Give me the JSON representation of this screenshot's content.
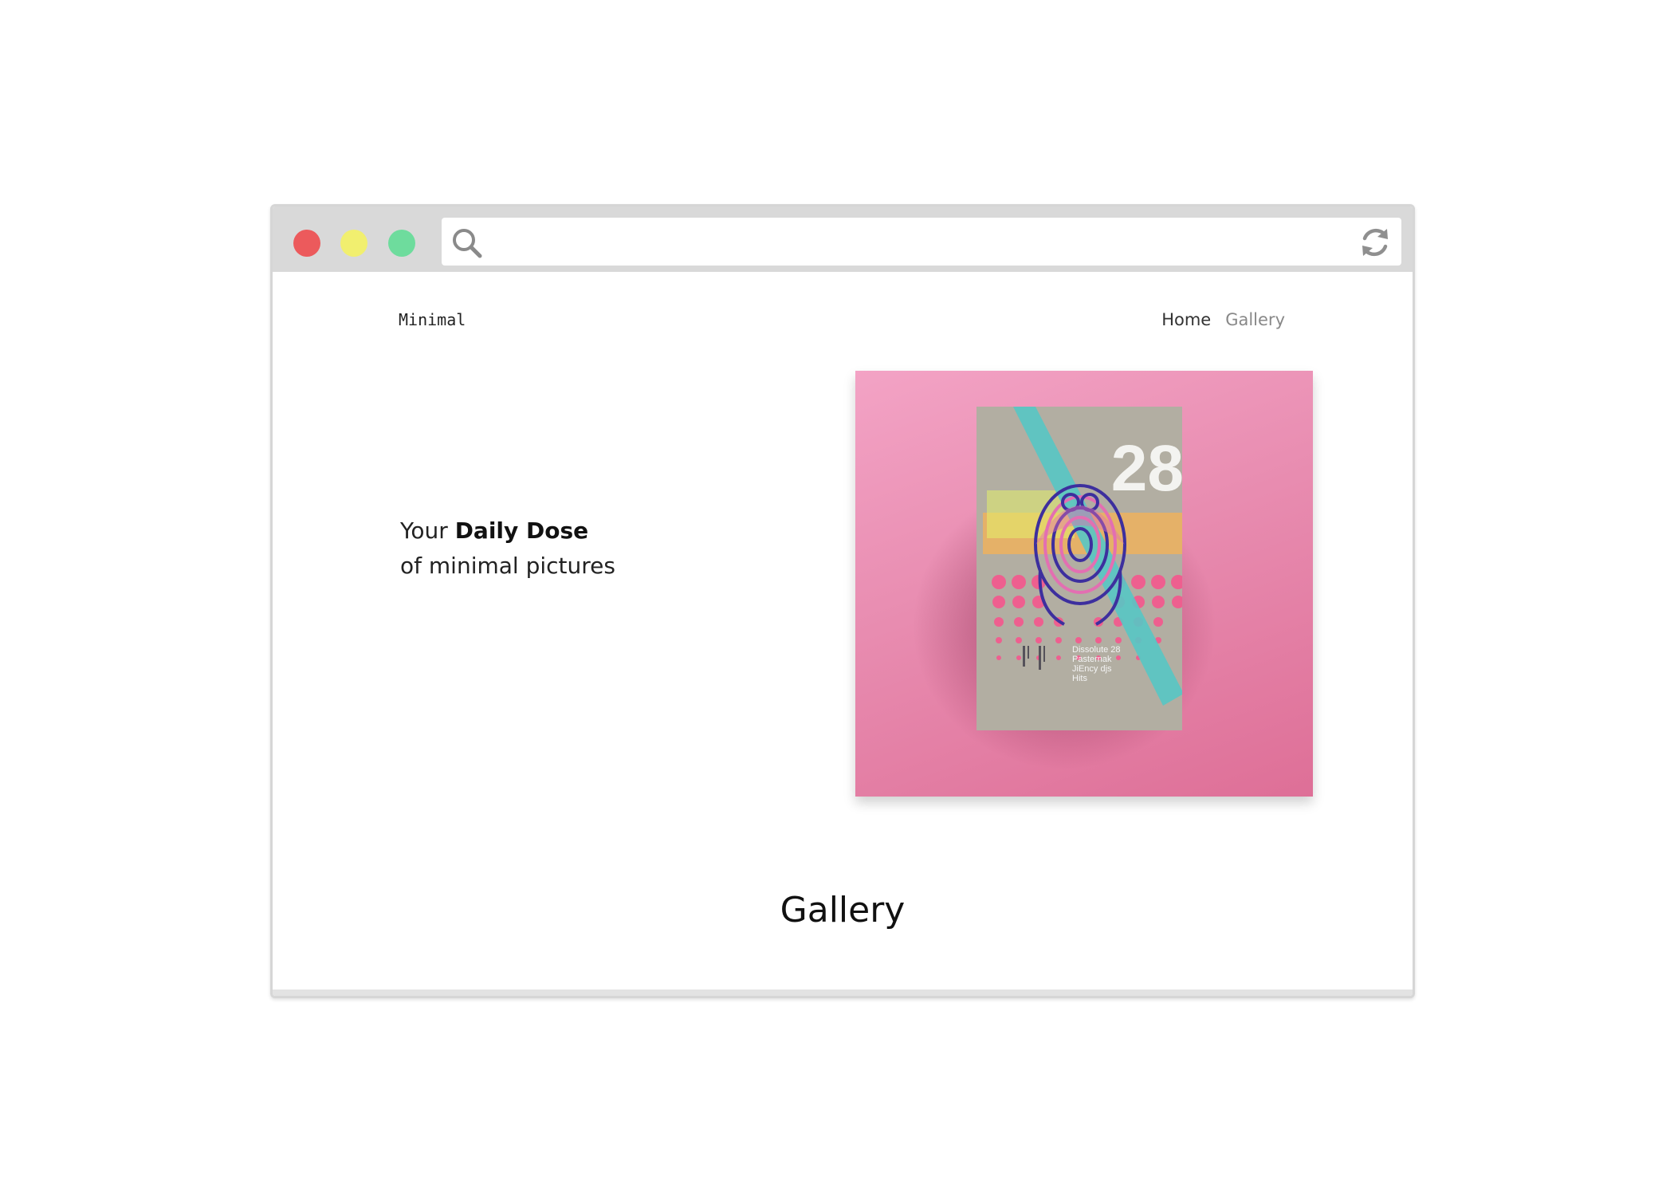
{
  "browser": {
    "traffic_lights": {
      "close": "#ec5a5c",
      "minimize": "#f1ef6f",
      "maximize": "#6edc9d"
    },
    "address_bar": {
      "value": "",
      "search_icon": "search-icon",
      "refresh_icon": "refresh-icon"
    }
  },
  "site": {
    "logo": "Minimal",
    "nav": {
      "home": "Home",
      "gallery": "Gallery"
    },
    "hero": {
      "line1_prefix": "Your",
      "line1_bold": "Daily Dose",
      "line2": "of minimal pictures",
      "image": {
        "background": "#e98cb2",
        "poster_number": "28",
        "poster_lines": [
          "Dissolute 28",
          "Pasternak",
          "JiEncy djs",
          "Hits"
        ]
      }
    },
    "section_title": "Gallery"
  }
}
